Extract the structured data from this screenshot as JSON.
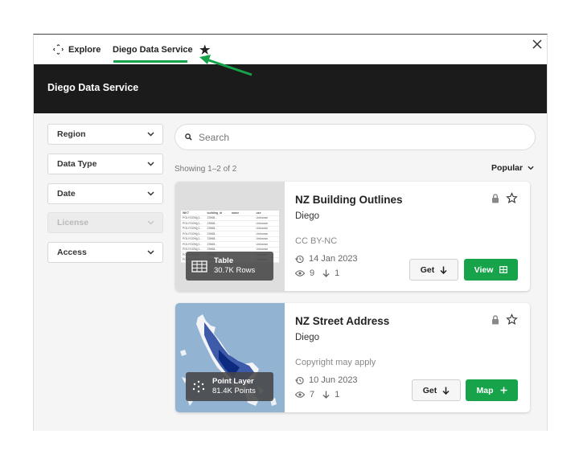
{
  "tabs": {
    "explore_label": "Explore",
    "service_label": "Diego Data Service"
  },
  "banner": {
    "title": "Diego Data Service"
  },
  "filters": [
    {
      "label": "Region"
    },
    {
      "label": "Data Type"
    },
    {
      "label": "Date"
    },
    {
      "label": "License",
      "disabled": true
    },
    {
      "label": "Access"
    }
  ],
  "search": {
    "placeholder": "Search"
  },
  "results": {
    "showing": "Showing 1–2 of 2",
    "sort_label": "Popular"
  },
  "cards": [
    {
      "title": "NZ Building Outlines",
      "owner": "Diego",
      "license": "CC BY-NC",
      "date": "14 Jan 2023",
      "views": "9",
      "downloads": "1",
      "get_label": "Get",
      "action_label": "View",
      "badge_type": "Table",
      "badge_count": "30.7K Rows",
      "table_headers": [
        "WKT",
        "building_id",
        "name",
        "use"
      ],
      "table_row": [
        "POLYGON((1...",
        "23968...",
        "",
        "Unknown"
      ]
    },
    {
      "title": "NZ Street Address",
      "owner": "Diego",
      "license": "Copyright may apply",
      "date": "10 Jun 2023",
      "views": "7",
      "downloads": "1",
      "get_label": "Get",
      "action_label": "Map",
      "badge_type": "Point Layer",
      "badge_count": "81.4K Points"
    }
  ],
  "colors": {
    "accent": "#17a34a",
    "banner": "#1b1b1b",
    "map_water": "#93b3d3",
    "map_points": "#0f2f8f"
  }
}
